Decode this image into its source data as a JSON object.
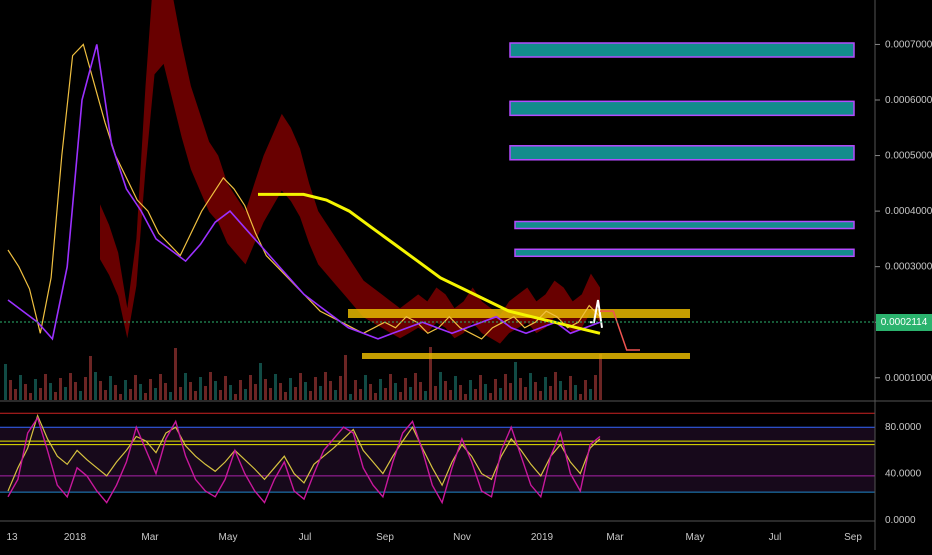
{
  "chart_data": [
    {
      "type": "line",
      "panel": "price",
      "x_ticks": [
        "13",
        "2018",
        "Mar",
        "May",
        "Jul",
        "Sep",
        "Nov",
        "2019",
        "Mar",
        "May",
        "Jul",
        "Sep"
      ],
      "y_ticks": [
        "0.0001000",
        "0.0002000",
        "0.0003000",
        "0.0004000",
        "0.0005000",
        "0.0006000",
        "0.0007000"
      ],
      "last_price": "0.0002114",
      "ylim": [
        6e-05,
        0.00078
      ],
      "series": [
        {
          "values": [
            0.00033,
            0.0003,
            0.00026,
            0.00018,
            0.00028,
            0.0005,
            0.00068,
            0.0007,
            0.00063,
            0.00056,
            0.0005,
            0.00046,
            0.00042,
            0.0004,
            0.00036,
            0.00034,
            0.00032,
            0.00036,
            0.0004,
            0.00043,
            0.00046,
            0.00044,
            0.00041,
            0.00036,
            0.00032,
            0.0003,
            0.00028,
            0.00026,
            0.00024,
            0.00022,
            0.00021,
            0.0002,
            0.00019,
            0.00018,
            0.00019,
            0.0002,
            0.00019,
            0.00021,
            0.0002,
            0.00018,
            0.00019,
            0.00021,
            0.00019,
            0.00018,
            0.00017,
            0.00019,
            0.0002,
            0.00021,
            0.00019,
            0.0002,
            0.00022,
            0.00021,
            0.00019,
            0.0002,
            0.00023,
            0.00021
          ]
        },
        {
          "values": [
            0.00024,
            0.00022,
            0.0002,
            0.00017,
            0.0003,
            0.0006,
            0.0007,
            0.00052,
            0.00044,
            0.0004,
            0.00035,
            0.00033,
            0.00031,
            0.00034,
            0.00038,
            0.0004,
            0.00037,
            0.00034,
            0.00031,
            0.00028,
            0.00025,
            0.00023,
            0.00021,
            0.00019,
            0.00018,
            0.00017,
            0.00018,
            0.00019,
            0.0002,
            0.00019,
            0.00018,
            0.00019,
            0.0002,
            0.00021,
            0.00019,
            0.00018,
            0.00019,
            0.0002,
            0.00018,
            0.00019,
            0.0002
          ]
        },
        {
          "values": [
            0.00043,
            0.00043,
            0.00043,
            0.00042,
            0.0004,
            0.00037,
            0.00034,
            0.00031,
            0.00028,
            0.00026,
            0.00024,
            0.00022,
            0.00021,
            0.0002,
            0.00019,
            0.00018
          ]
        },
        {
          "values": [
            0.0002,
            0.0002,
            0.00024,
            0.00019
          ]
        },
        {
          "values": [
            0.00022,
            0.00022,
            0.00015,
            0.00015
          ]
        }
      ],
      "target_boxes": [
        0.00069,
        0.000585,
        0.000505,
        0.000375,
        0.000325
      ],
      "colors": {
        "up": "#26a69a",
        "down": "#ef5350",
        "cloud_red": "#8b0000",
        "cloud_green": "#1f5f1f",
        "ma": "#f5f500",
        "purple": "#9b30ff",
        "box_fill": "#138c8c",
        "box_border": "#b44bff",
        "range_fill": "#e6b800"
      }
    },
    {
      "type": "line",
      "panel": "oscillator",
      "y_ticks": [
        "0.0000",
        "40.0000",
        "80.0000"
      ],
      "ylim": [
        0,
        100
      ],
      "levels": [
        92,
        80,
        68,
        65,
        38,
        24
      ],
      "series": [
        {
          "values": [
            25,
            45,
            62,
            90,
            70,
            55,
            48,
            60,
            52,
            45,
            38,
            50,
            60,
            72,
            68,
            58,
            75,
            80,
            64,
            55,
            48,
            42,
            50,
            60,
            52,
            44,
            35,
            45,
            55,
            40,
            32,
            48,
            55,
            62,
            70,
            78,
            60,
            50,
            40,
            55,
            68,
            80,
            62,
            45,
            30,
            50,
            65,
            55,
            40,
            35,
            55,
            70,
            60,
            48,
            38,
            55,
            65,
            50,
            40,
            62,
            70
          ]
        },
        {
          "values": [
            20,
            35,
            75,
            88,
            60,
            30,
            20,
            45,
            38,
            25,
            15,
            30,
            50,
            80,
            60,
            40,
            70,
            85,
            55,
            35,
            25,
            20,
            35,
            60,
            40,
            25,
            15,
            35,
            50,
            25,
            18,
            40,
            60,
            70,
            80,
            75,
            45,
            30,
            20,
            50,
            75,
            85,
            60,
            30,
            15,
            45,
            70,
            50,
            25,
            20,
            60,
            80,
            55,
            30,
            20,
            55,
            75,
            40,
            25,
            65,
            72
          ]
        }
      ]
    }
  ]
}
